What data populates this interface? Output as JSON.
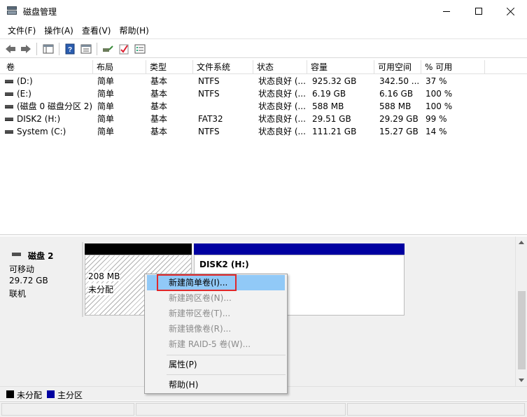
{
  "window": {
    "title": "磁盘管理",
    "icon": "disk-management-icon",
    "controls": [
      "minimize-icon",
      "maximize-icon",
      "close-icon"
    ]
  },
  "menu": [
    "文件(F)",
    "操作(A)",
    "查看(V)",
    "帮助(H)"
  ],
  "toolbar": [
    "back-icon",
    "forward-icon",
    "console-view-icon",
    "help-book-icon",
    "properties-icon",
    "connect-icon",
    "check-icon",
    "settings-list-icon"
  ],
  "volume_list": {
    "columns": [
      "卷",
      "布局",
      "类型",
      "文件系统",
      "状态",
      "容量",
      "可用空间",
      "% 可用"
    ],
    "rows": [
      {
        "volume": "(D:)",
        "layout": "简单",
        "type": "基本",
        "fs": "NTFS",
        "status": "状态良好 (...",
        "capacity": "925.32 GB",
        "free": "342.50 ...",
        "pct": "37 %"
      },
      {
        "volume": "(E:)",
        "layout": "简单",
        "type": "基本",
        "fs": "NTFS",
        "status": "状态良好 (...",
        "capacity": "6.19 GB",
        "free": "6.16 GB",
        "pct": "100 %"
      },
      {
        "volume": "(磁盘 0 磁盘分区 2)",
        "layout": "简单",
        "type": "基本",
        "fs": "",
        "status": "状态良好 (...",
        "capacity": "588 MB",
        "free": "588 MB",
        "pct": "100 %"
      },
      {
        "volume": "DISK2 (H:)",
        "layout": "简单",
        "type": "基本",
        "fs": "FAT32",
        "status": "状态良好 (...",
        "capacity": "29.51 GB",
        "free": "29.29 GB",
        "pct": "99 %"
      },
      {
        "volume": "System (C:)",
        "layout": "简单",
        "type": "基本",
        "fs": "NTFS",
        "status": "状态良好 (...",
        "capacity": "111.21 GB",
        "free": "15.27 GB",
        "pct": "14 %"
      }
    ]
  },
  "disk": {
    "name": "磁盘 2",
    "kind": "可移动",
    "size": "29.72 GB",
    "state": "联机",
    "unallocated": {
      "size": "208 MB",
      "label": "未分配"
    },
    "primary": {
      "name": "DISK2 (H:)"
    }
  },
  "context_menu": {
    "items": [
      {
        "label": "新建简单卷(I)...",
        "enabled": true,
        "highlighted": true
      },
      {
        "label": "新建跨区卷(N)...",
        "enabled": false
      },
      {
        "label": "新建带区卷(T)...",
        "enabled": false
      },
      {
        "label": "新建镜像卷(R)...",
        "enabled": false
      },
      {
        "label": "新建 RAID-5 卷(W)...",
        "enabled": false
      },
      {
        "label": "属性(P)",
        "enabled": true
      },
      {
        "label": "帮助(H)",
        "enabled": true
      }
    ]
  },
  "legend": [
    {
      "label": "未分配",
      "color": "#000000"
    },
    {
      "label": "主分区",
      "color": "#0000a0"
    }
  ]
}
